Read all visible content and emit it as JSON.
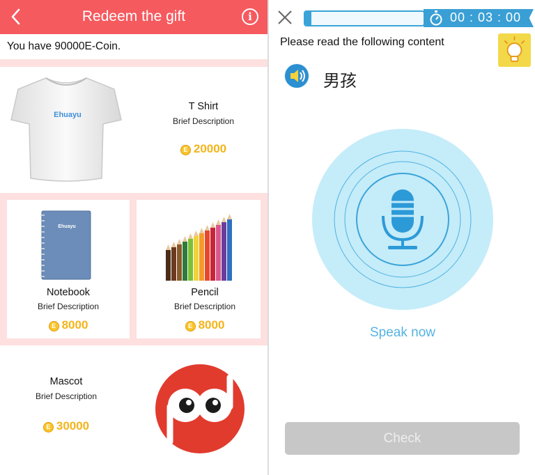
{
  "redeem": {
    "title": "Redeem the gift",
    "back_icon": "chevron-left-icon",
    "info_icon": "info-icon",
    "info_glyph": "i",
    "coins_prefix": "You have ",
    "coins_value": "90000",
    "coins_suffix": "E-Coin.",
    "coin_glyph": "E",
    "items": [
      {
        "name": "T Shirt",
        "description": "Brief Description",
        "price": "20000",
        "image": "tshirt-image",
        "shirt_text": "Ehuayu"
      },
      {
        "name": "Notebook",
        "description": "Brief Description",
        "price": "8000",
        "image": "notebook-image",
        "cover_text": "Ehuayu"
      },
      {
        "name": "Pencil",
        "description": "Brief Description",
        "price": "8000",
        "image": "colored-pencils-image"
      },
      {
        "name": "Mascot",
        "description": "Brief Description",
        "price": "30000",
        "image": "mascot-image"
      }
    ],
    "colors": {
      "header": "#f55a5f",
      "separator": "#fde0df",
      "price": "#f4b41a"
    }
  },
  "speak": {
    "close_icon": "close-icon",
    "progress": 0.05,
    "timer": "00 : 03 : 00",
    "timer_icon": "stopwatch-icon",
    "prompt": "Please read the following content",
    "hint_icon": "lightbulb-icon",
    "speaker_icon": "speaker-icon",
    "word": "男孩",
    "mic_icon": "microphone-icon",
    "speak_label": "Speak now",
    "check_label": "Check",
    "colors": {
      "accent": "#3a9fd5",
      "mic": "#2d9ad8",
      "halo": "#c5ecf9",
      "check_disabled": "#c7c7c7"
    }
  }
}
